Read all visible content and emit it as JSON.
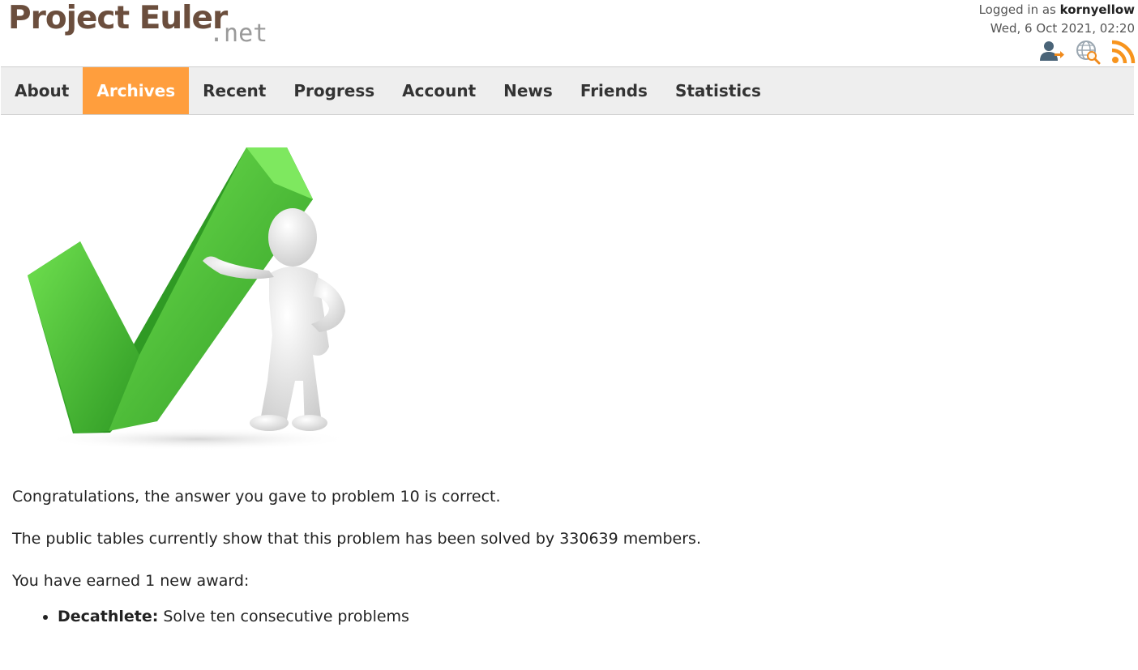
{
  "header": {
    "logo_main": "Project Euler",
    "logo_suffix": ".net",
    "logged_in_prefix": "Logged in as",
    "username": "kornyellow",
    "datetime": "Wed, 6 Oct 2021, 02:20",
    "icons": [
      "sign-out-icon",
      "search-globe-icon",
      "rss-icon"
    ]
  },
  "nav": {
    "items": [
      {
        "label": "About"
      },
      {
        "label": "Archives",
        "active": true
      },
      {
        "label": "Recent"
      },
      {
        "label": "Progress"
      },
      {
        "label": "Account"
      },
      {
        "label": "News"
      },
      {
        "label": "Friends"
      },
      {
        "label": "Statistics"
      }
    ]
  },
  "main": {
    "congrats": "Congratulations, the answer you gave to problem 10 is correct.",
    "solved_line": "The public tables currently show that this problem has been solved by 330639 members.",
    "earned_line": "You have earned 1 new award:",
    "awards": [
      {
        "name": "Decathlete:",
        "description": "Solve ten consecutive problems"
      }
    ]
  },
  "colors": {
    "accent": "#ff9e3d",
    "logo_brown": "#6b4e3d",
    "checkmark_green": "#4fc73a",
    "navbar_bg": "#eeeeee"
  }
}
